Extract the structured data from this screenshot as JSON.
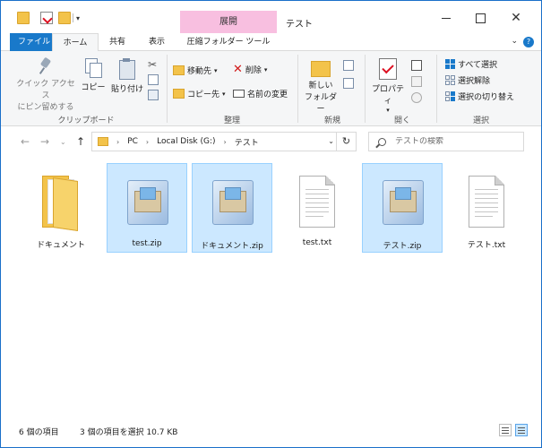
{
  "window": {
    "context_tab": "展開",
    "title": "テスト"
  },
  "ribbon_tabs": {
    "file": "ファイル",
    "home": "ホーム",
    "share": "共有",
    "view": "表示",
    "compressed_tools": "圧縮フォルダー ツール"
  },
  "ribbon": {
    "clipboard": {
      "pin_line1": "クイック アクセス",
      "pin_line2": "にピン留めする",
      "copy": "コピー",
      "paste": "貼り付け",
      "group": "クリップボード"
    },
    "organize": {
      "move_to": "移動先",
      "copy_to": "コピー先",
      "delete": "削除",
      "rename": "名前の変更",
      "group": "整理"
    },
    "new": {
      "new_folder_line1": "新しい",
      "new_folder_line2": "フォルダー",
      "group": "新規"
    },
    "open": {
      "properties": "プロパティ",
      "group": "開く"
    },
    "select": {
      "select_all": "すべて選択",
      "select_none": "選択解除",
      "invert": "選択の切り替え",
      "group": "選択"
    }
  },
  "address": {
    "crumbs": [
      "PC",
      "Local Disk (G:)",
      "テスト"
    ],
    "search_placeholder": "テストの検索"
  },
  "files": [
    {
      "name": "ドキュメント",
      "type": "folder",
      "selected": false
    },
    {
      "name": "test.zip",
      "type": "zip",
      "selected": true
    },
    {
      "name": "ドキュメント.zip",
      "type": "zip",
      "selected": true
    },
    {
      "name": "test.txt",
      "type": "txt",
      "selected": false
    },
    {
      "name": "テスト.zip",
      "type": "zip",
      "selected": true
    },
    {
      "name": "テスト.txt",
      "type": "txt",
      "selected": false
    }
  ],
  "status": {
    "item_count": "6 個の項目",
    "selection": "3 個の項目を選択  10.7 KB"
  },
  "colors": {
    "accent": "#1979ca",
    "context_tab": "#f8bfe0",
    "selection_bg": "#cce8ff",
    "selection_border": "#99d1ff",
    "folder": "#f3c34a"
  }
}
